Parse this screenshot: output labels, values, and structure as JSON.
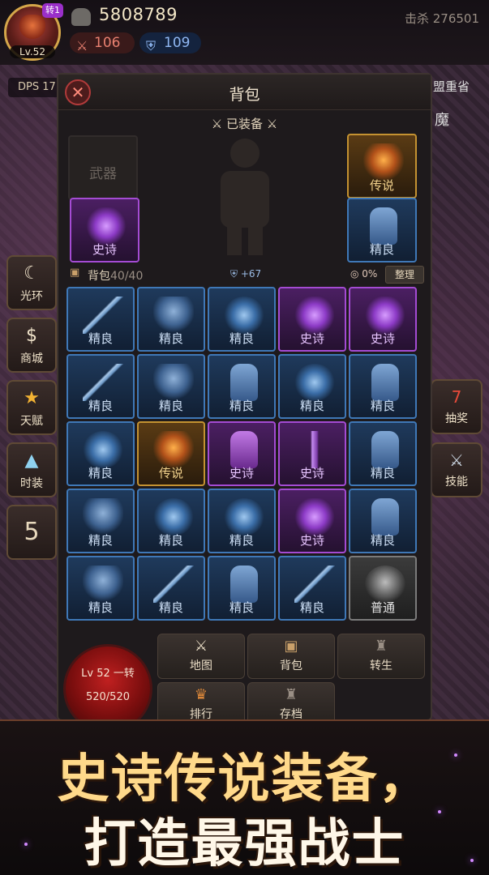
{
  "player": {
    "level": "Lv.52",
    "rebirth_badge": "转1",
    "gold": "5808789",
    "attack": "106",
    "defense": "109",
    "kills": "击杀 276501"
  },
  "hud": {
    "dps_label": "DPS 17",
    "right_label": "盟重省",
    "right_demon": "魔"
  },
  "left_sidebar": [
    {
      "label": "光环",
      "icon": "halo-icon"
    },
    {
      "label": "商城",
      "icon": "money-bag-icon"
    },
    {
      "label": "天赋",
      "icon": "star-icon"
    },
    {
      "label": "时装",
      "icon": "dress-icon"
    }
  ],
  "left_sidebar_number": "5",
  "right_sidebar": [
    {
      "label": "抽奖",
      "icon": "slot-machine-icon"
    },
    {
      "label": "技能",
      "icon": "crossed-swords-icon"
    }
  ],
  "panel": {
    "title": "背包",
    "equipped_title": "⚔ 已装备 ⚔",
    "close_icon": "close-icon"
  },
  "equipped": {
    "weapon": {
      "label": "武器",
      "rarity": "empty"
    },
    "helmet": {
      "label": "传说",
      "rarity": "legend"
    },
    "chest": {
      "label": "史诗",
      "rarity": "epic"
    },
    "boots": {
      "label": "精良",
      "rarity": "fine"
    }
  },
  "bag": {
    "label": "背包",
    "count": "40/40",
    "power": "+67",
    "percent": "0%",
    "sort_label": "整理"
  },
  "bag_items": [
    [
      {
        "label": "精良",
        "rarity": "fine",
        "art": "sword"
      },
      {
        "label": "精良",
        "rarity": "fine",
        "art": "armor"
      },
      {
        "label": "精良",
        "rarity": "fine",
        "art": "shield"
      },
      {
        "label": "史诗",
        "rarity": "epic",
        "art": "demon"
      },
      {
        "label": "史诗",
        "rarity": "epic",
        "art": "demon"
      }
    ],
    [
      {
        "label": "精良",
        "rarity": "fine",
        "art": "sword"
      },
      {
        "label": "精良",
        "rarity": "fine",
        "art": "armor"
      },
      {
        "label": "精良",
        "rarity": "fine",
        "art": "boots"
      },
      {
        "label": "精良",
        "rarity": "fine",
        "art": "shield"
      },
      {
        "label": "精良",
        "rarity": "fine",
        "art": "boots"
      }
    ],
    [
      {
        "label": "精良",
        "rarity": "fine",
        "art": "shield"
      },
      {
        "label": "传说",
        "rarity": "legend",
        "art": "legend"
      },
      {
        "label": "史诗",
        "rarity": "epic",
        "art": "purple-boots"
      },
      {
        "label": "史诗",
        "rarity": "epic",
        "art": "purple-sword"
      },
      {
        "label": "精良",
        "rarity": "fine",
        "art": "boots"
      }
    ],
    [
      {
        "label": "精良",
        "rarity": "fine",
        "art": "armor"
      },
      {
        "label": "精良",
        "rarity": "fine",
        "art": "shield"
      },
      {
        "label": "精良",
        "rarity": "fine",
        "art": "shield"
      },
      {
        "label": "史诗",
        "rarity": "epic",
        "art": "demon"
      },
      {
        "label": "精良",
        "rarity": "fine",
        "art": "boots"
      }
    ],
    [
      {
        "label": "精良",
        "rarity": "fine",
        "art": "armor"
      },
      {
        "label": "精良",
        "rarity": "fine",
        "art": "sword"
      },
      {
        "label": "精良",
        "rarity": "fine",
        "art": "boots"
      },
      {
        "label": "精良",
        "rarity": "fine",
        "art": "sword"
      },
      {
        "label": "普通",
        "rarity": "common",
        "art": "helm"
      }
    ]
  ],
  "level_orb": {
    "line1": "Lv 52 一转",
    "hp": "520/520"
  },
  "bottom_nav": [
    {
      "label": "地图",
      "icon": "map-icon"
    },
    {
      "label": "背包",
      "icon": "bag-icon"
    },
    {
      "label": "转生",
      "icon": "armor-icon"
    },
    {
      "label": "排行",
      "icon": "ranking-icon"
    },
    {
      "label": "存档",
      "icon": "save-icon"
    }
  ],
  "promo": {
    "line1": "史诗传说装备，",
    "line2": "打造最强战士"
  },
  "colors": {
    "fine": "#3f78b7",
    "epic": "#a44bd3",
    "legend": "#c49231",
    "common": "#7b7b7b"
  }
}
